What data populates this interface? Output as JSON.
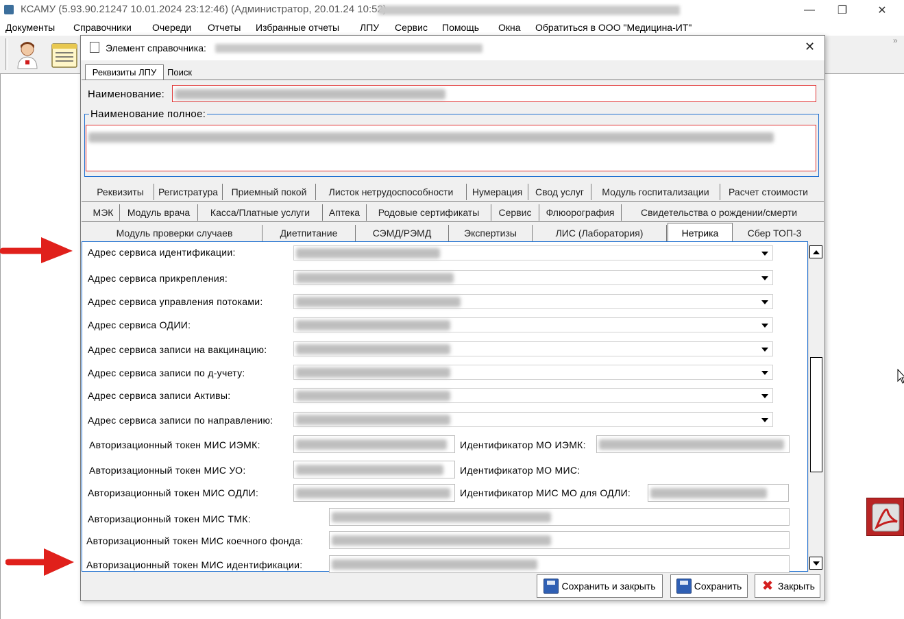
{
  "window": {
    "title": "КСАМУ (5.93.90.21247 10.01.2024 23:12:46) (Администратор, 20.01.24 10:52)",
    "minimize": "—",
    "restore": "❐",
    "close": "✕"
  },
  "menu": [
    "Документы",
    "Справочники",
    "Очереди",
    "Отчеты",
    "Избранные отчеты",
    "ЛПУ",
    "Сервис",
    "Помощь",
    "Окна",
    "Обратиться в ООО \"Медицина-ИТ\""
  ],
  "toolbar": {
    "overflow": "»"
  },
  "dialog": {
    "title": "Элемент справочника:",
    "close": "✕",
    "top_tabs": [
      "Реквизиты ЛПУ",
      "Поиск"
    ],
    "name_label": "Наименование:",
    "fullname_label": "Наименование полное:",
    "tabs_row1": [
      "Реквизиты",
      "Регистратура",
      "Приемный покой",
      "Листок нетрудоспособности",
      "Нумерация",
      "Свод услуг",
      "Модуль госпитализации",
      "Расчет стоимости"
    ],
    "tabs_row2": [
      "МЭК",
      "Модуль врача",
      "Касса/Платные услуги",
      "Аптека",
      "Родовые сертификаты",
      "Сервис",
      "Флюорография",
      "Свидетельства о рождении/смерти"
    ],
    "tabs_row3": [
      "Модуль проверки случаев",
      "Диетпитание",
      "СЭМД/РЭМД",
      "Экспертизы",
      "ЛИС (Лаборатория)",
      "Нетрика",
      "Сбер ТОП-3"
    ],
    "active_tab": "Нетрика",
    "combo_fields": [
      "Адрес сервиса идентификации:",
      "Адрес сервиса прикрепления:",
      "Адрес сервиса управления потоками:",
      "Адрес сервиса ОДИИ:",
      "Адрес сервиса записи на вакцинацию:",
      "Адрес сервиса записи по д-учету:",
      "Адрес сервиса записи Активы:",
      "Адрес сервиса записи по направлению:"
    ],
    "token_rows": [
      {
        "left": "Авторизационный токен МИС ИЭМК:",
        "right": "Идентификатор МО ИЭМК:"
      },
      {
        "left": "Авторизационный токен МИС УО:",
        "right": "Идентификатор МО МИС:"
      },
      {
        "left": "Авторизационный токен МИС ОДЛИ:",
        "right": "Идентификатор МИС МО для ОДЛИ:"
      }
    ],
    "wide_tokens": [
      "Авторизационный токен МИС ТМК:",
      "Авторизационный токен МИС коечного фонда:",
      "Авторизационный токен МИС идентификации:"
    ],
    "buttons": {
      "save_close": "Сохранить и закрыть",
      "save": "Сохранить",
      "close": "Закрыть"
    }
  },
  "colors": {
    "arrow": "#e0201b",
    "required_border": "#e03030",
    "group_border": "#1e6fd0"
  }
}
